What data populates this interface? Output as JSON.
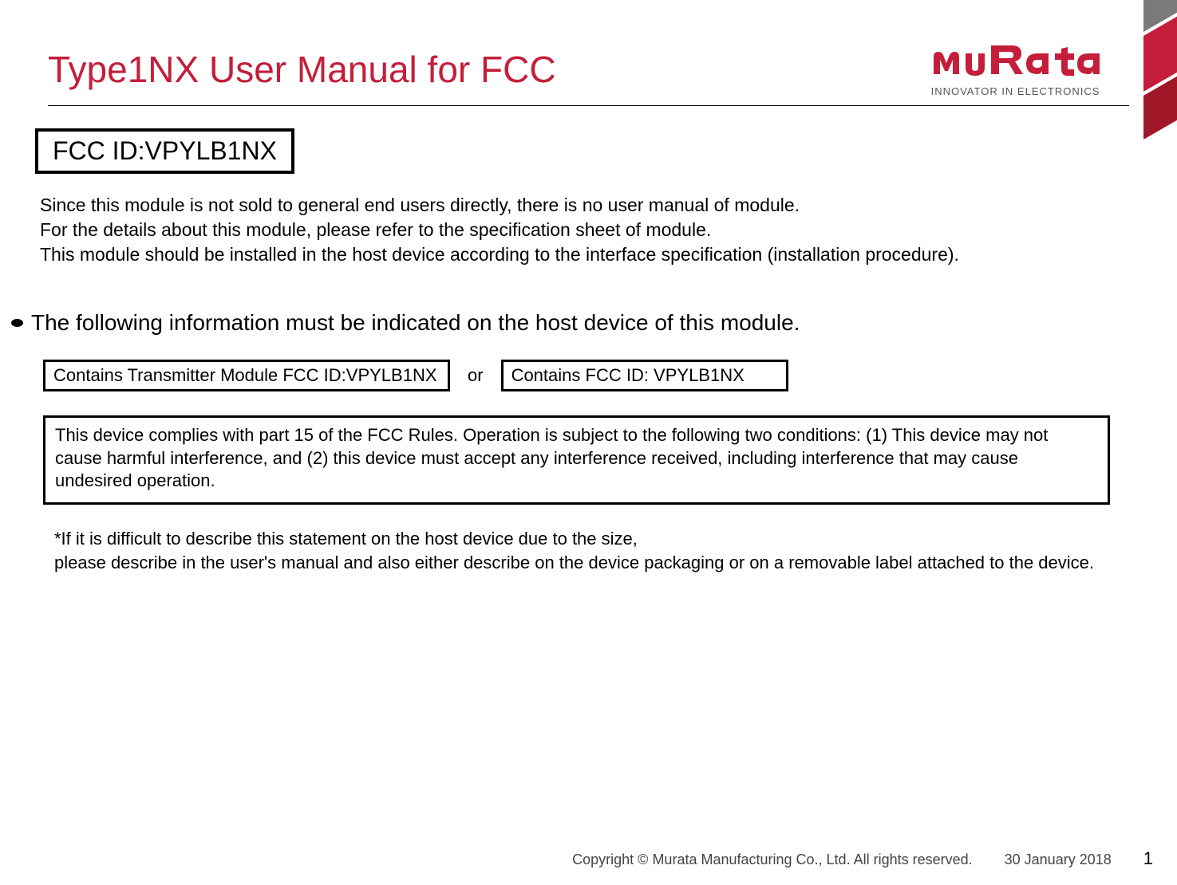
{
  "header": {
    "title": "Type1NX User Manual for FCC",
    "logo_tagline": "INNOVATOR IN ELECTRONICS"
  },
  "fcc_id_box": "FCC ID:VPYLB1NX",
  "intro": {
    "line1": "Since this module is not sold to general end users directly, there is no user manual of module.",
    "line2": "For the details about this module, please refer to the specification sheet of module.",
    "line3": "This module should be installed in the host device according to the interface specification (installation procedure)."
  },
  "bullet_heading": "The following information must be indicated on the host device of this module.",
  "labels": {
    "box1": "Contains Transmitter Module FCC ID:VPYLB1NX",
    "or": "or",
    "box2": "Contains FCC ID: VPYLB1NX"
  },
  "compliance": "This device complies with part 15 of the FCC Rules. Operation is subject to the following two conditions: (1) This device may not cause harmful interference, and (2) this device must accept any interference received, including interference that may cause undesired operation.",
  "note": {
    "line1": "*If it is difficult to describe this statement on the host device due to the size,",
    "line2": "please describe in the user's manual and also either describe on the device packaging or on a removable label attached to the device."
  },
  "footer": {
    "copyright": "Copyright © Murata Manufacturing Co., Ltd. All rights reserved.",
    "date": "30 January 2018",
    "page": "1"
  },
  "colors": {
    "brand_red": "#c41e3a"
  }
}
